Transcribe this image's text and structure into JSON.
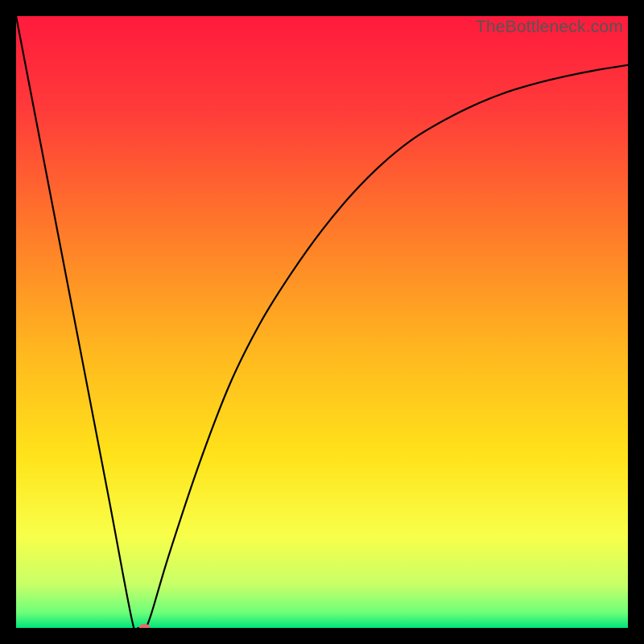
{
  "watermark": "TheBottleneck.com",
  "chart_data": {
    "type": "line",
    "title": "",
    "xlabel": "",
    "ylabel": "",
    "xlim": [
      0,
      100
    ],
    "ylim": [
      0,
      100
    ],
    "series": [
      {
        "name": "curve",
        "x": [
          0,
          5,
          10,
          15,
          19,
          20,
          21,
          22,
          25,
          30,
          35,
          40,
          45,
          50,
          55,
          60,
          65,
          70,
          75,
          80,
          85,
          90,
          95,
          100
        ],
        "y": [
          100,
          74,
          48,
          22,
          1,
          0,
          0,
          2,
          12,
          27,
          40,
          50,
          58,
          65,
          71,
          76,
          80,
          83,
          85.5,
          87.5,
          89,
          90.2,
          91.2,
          92
        ]
      }
    ],
    "marker": {
      "x": 21,
      "y": 0,
      "color": "#e46a6a",
      "rx": 7,
      "ry": 5
    },
    "gradient_stops": [
      {
        "offset": 0.0,
        "color": "#ff1a3c"
      },
      {
        "offset": 0.15,
        "color": "#ff3a3a"
      },
      {
        "offset": 0.35,
        "color": "#ff7a2a"
      },
      {
        "offset": 0.55,
        "color": "#ffb81f"
      },
      {
        "offset": 0.72,
        "color": "#ffe31a"
      },
      {
        "offset": 0.85,
        "color": "#f8ff4a"
      },
      {
        "offset": 0.93,
        "color": "#c7ff68"
      },
      {
        "offset": 0.975,
        "color": "#6dff7a"
      },
      {
        "offset": 1.0,
        "color": "#00e57a"
      }
    ]
  }
}
